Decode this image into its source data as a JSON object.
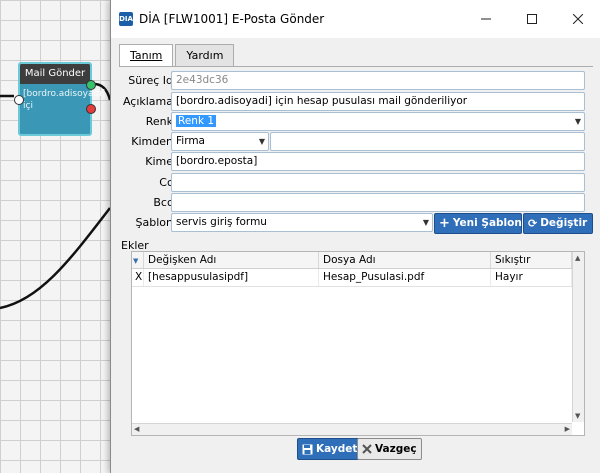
{
  "node": {
    "title": "Mail Gönder",
    "body_line1": "[bordro.adisoyadı]",
    "body_line2": "içi"
  },
  "dialog": {
    "title": "DİA [FLW1001] E-Posta Gönder",
    "icon_text": "DIA",
    "tabs": [
      {
        "label": "Tanım"
      },
      {
        "label": "Yardım"
      }
    ],
    "labels": {
      "surec_id": "Süreç Id",
      "aciklama": "Açıklama",
      "renk": "Renk",
      "kimden": "Kimden",
      "kime": "Kime",
      "cc": "Cc",
      "bcc": "Bcc",
      "sablon": "Şablon",
      "ekler": "Ekler"
    },
    "values": {
      "surec_id": "2e43dc36",
      "aciklama": "[bordro.adisoyadi] için hesap pusulası mail gönderiliyor",
      "renk": "Renk 1",
      "kimden_type": "Firma",
      "kimden_value": "",
      "kime": "[bordro.eposta]",
      "cc": "",
      "bcc": "",
      "sablon": "servis giriş formu"
    },
    "buttons": {
      "yeni_sablon": "Yeni Şablon",
      "degistir": "Değiştir",
      "kaydet": "Kaydet",
      "vazgec": "Vazgeç"
    },
    "grid": {
      "columns": [
        "Değişken Adı",
        "Dosya Adı",
        "Sıkıştır"
      ],
      "rows": [
        {
          "x": "X",
          "degisken": "[hesappusulasipdf]",
          "dosya": "Hesap_Pusulasi.pdf",
          "sikistir": "Hayır"
        }
      ]
    },
    "colors": {
      "accent": "#2f6eb8",
      "node": "#3a97b6"
    }
  }
}
